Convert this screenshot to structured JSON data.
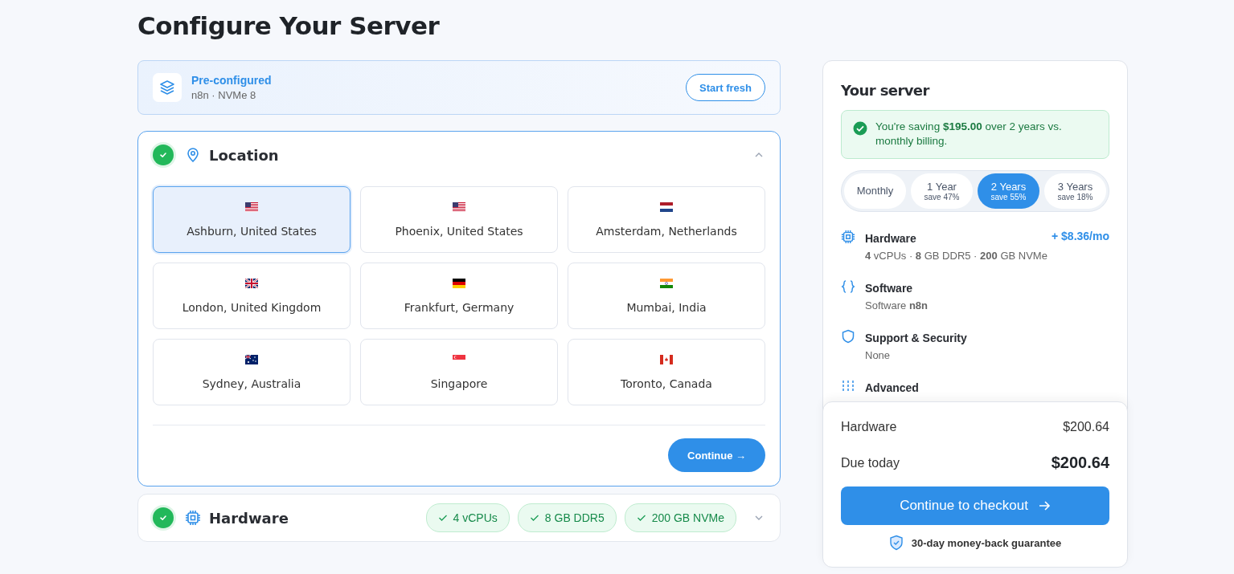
{
  "page_title": "Configure Your Server",
  "preconfigured": {
    "title": "Pre-configured",
    "subtitle": "n8n · NVMe 8",
    "button": "Start fresh"
  },
  "location_section": {
    "title": "Location",
    "done": true,
    "expanded": true,
    "continue_button": "Continue →",
    "locations": [
      {
        "name": "Ashburn, United States",
        "kind": "us",
        "selected": true
      },
      {
        "name": "Phoenix, United States",
        "kind": "us",
        "selected": false
      },
      {
        "name": "Amsterdam, Netherlands",
        "kind": "nl",
        "selected": false
      },
      {
        "name": "London, United Kingdom",
        "kind": "gb",
        "selected": false
      },
      {
        "name": "Frankfurt, Germany",
        "kind": "de",
        "selected": false
      },
      {
        "name": "Mumbai, India",
        "kind": "in",
        "selected": false
      },
      {
        "name": "Sydney, Australia",
        "kind": "au",
        "selected": false
      },
      {
        "name": "Singapore",
        "kind": "sg",
        "selected": false
      },
      {
        "name": "Toronto, Canada",
        "kind": "ca",
        "selected": false
      }
    ]
  },
  "hardware_section": {
    "title": "Hardware",
    "done": true,
    "expanded": false,
    "chips": [
      "4 vCPUs",
      "8 GB DDR5",
      "200 GB NVMe"
    ]
  },
  "summary": {
    "title": "Your server",
    "savings": "You're saving **$195.00** over 2 years vs. monthly billing.",
    "billing": [
      {
        "label": "Monthly",
        "selected": false
      },
      {
        "label": "1 Year",
        "note": "save 47%",
        "selected": false
      },
      {
        "label": "2 Years",
        "note": "save 55%",
        "selected": true
      },
      {
        "label": "3 Years",
        "note": "save 18%",
        "selected": false
      }
    ],
    "items": [
      {
        "kind": "hardware",
        "title": "Hardware",
        "price": "+ $8.36/mo",
        "detail": "**4** vCPUs · **8** GB DDR5 · **200** GB NVMe"
      },
      {
        "kind": "software",
        "title": "Software",
        "detail": "Software **n8n**"
      },
      {
        "kind": "security",
        "title": "Support & Security",
        "detail": "None"
      },
      {
        "kind": "advanced",
        "title": "Advanced"
      }
    ],
    "totals": [
      {
        "label": "Hardware",
        "value": "$200.64",
        "kind": "line"
      },
      {
        "label": "Due today",
        "value": "$200.64",
        "kind": "total"
      }
    ],
    "checkout_button": "Continue to checkout",
    "guarantee": "30-day money-back guarantee"
  }
}
